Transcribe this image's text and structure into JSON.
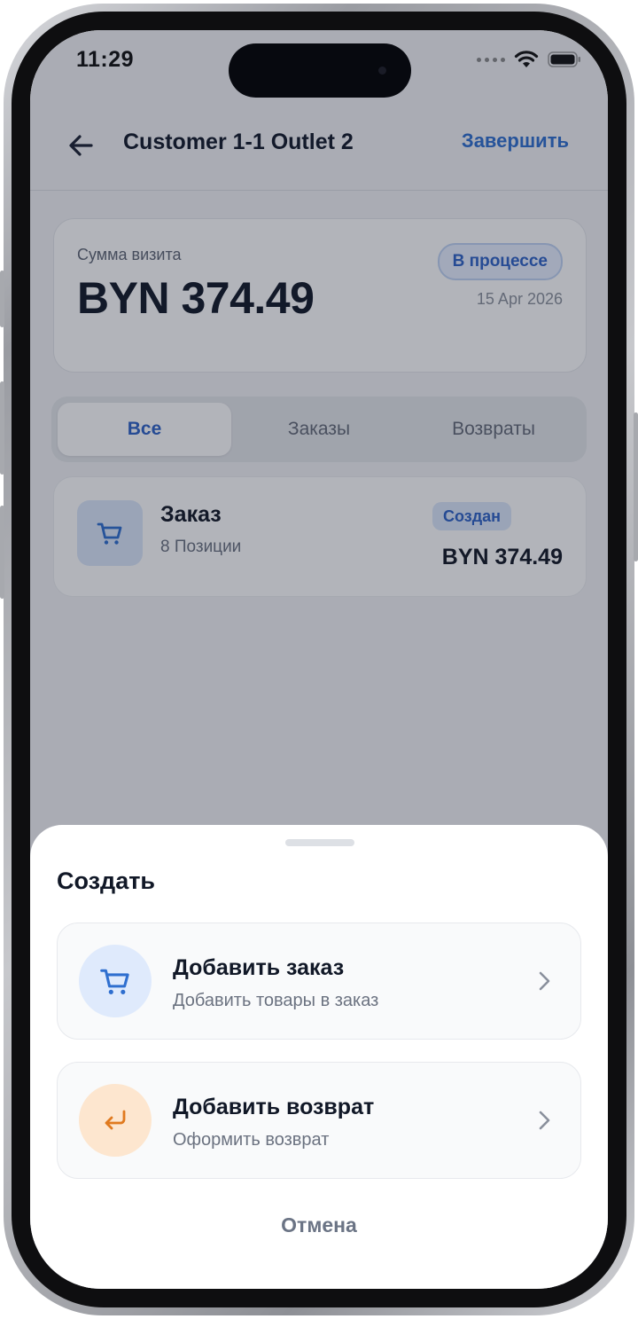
{
  "status_bar": {
    "time": "11:29"
  },
  "header": {
    "title": "Customer 1-1 Outlet 2",
    "finish_label": "Завершить"
  },
  "summary": {
    "label": "Сумма визита",
    "amount": "BYN 374.49",
    "status": "В процессе",
    "date": "15 Apr 2026"
  },
  "tabs": [
    {
      "label": "Все",
      "active": true
    },
    {
      "label": "Заказы",
      "active": false
    },
    {
      "label": "Возвраты",
      "active": false
    }
  ],
  "order": {
    "title": "Заказ",
    "subtitle": "8 Позиции",
    "badge": "Создан",
    "amount": "BYN 374.49"
  },
  "sheet": {
    "title": "Создать",
    "actions": [
      {
        "title": "Добавить заказ",
        "subtitle": "Добавить товары в заказ",
        "icon": "cart-icon",
        "color": "#2f6fcf"
      },
      {
        "title": "Добавить возврат",
        "subtitle": "Оформить возврат",
        "icon": "return-arrow-icon",
        "color": "#e07a1f"
      }
    ],
    "cancel_label": "Отмена"
  }
}
